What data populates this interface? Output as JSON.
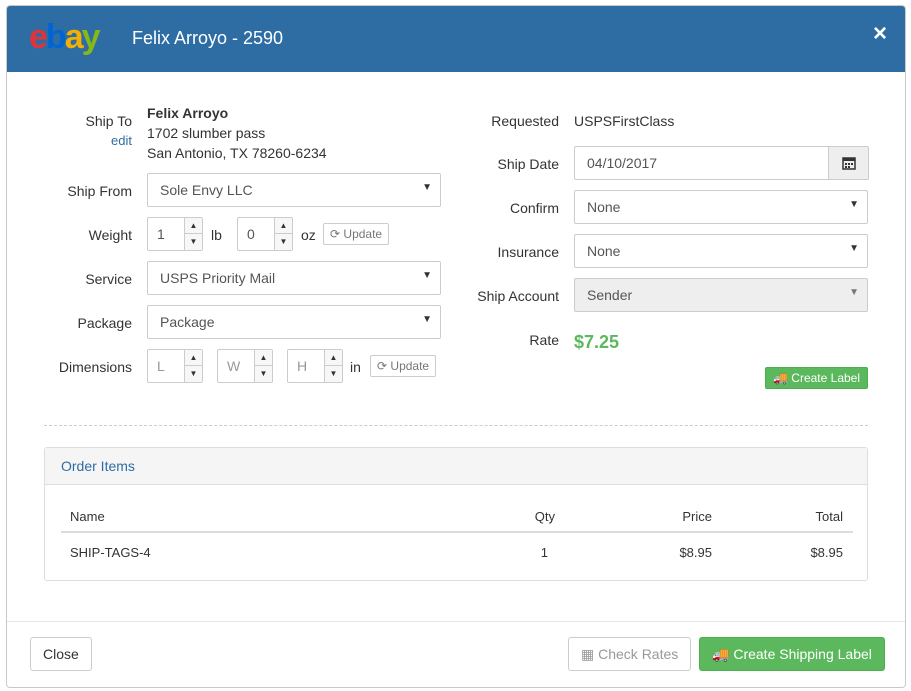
{
  "header": {
    "title": "Felix Arroyo - 2590",
    "close_label": "×",
    "logo": {
      "e": "e",
      "b": "b",
      "a": "a",
      "y": "y"
    }
  },
  "left": {
    "ship_to_label": "Ship To",
    "edit_label": "edit",
    "ship_to_name": "Felix Arroyo",
    "ship_to_line1": "1702 slumber pass",
    "ship_to_line2": "San Antonio, TX 78260-6234",
    "ship_from_label": "Ship From",
    "ship_from_value": "Sole Envy LLC",
    "weight_label": "Weight",
    "weight_lb": "1",
    "lb_unit": "lb",
    "weight_oz": "0",
    "oz_unit": "oz",
    "update_label": "Update",
    "service_label": "Service",
    "service_value": "USPS Priority Mail",
    "package_label": "Package",
    "package_value": "Package",
    "dimensions_label": "Dimensions",
    "dim_l_placeholder": "L",
    "dim_w_placeholder": "W",
    "dim_h_placeholder": "H",
    "in_unit": "in",
    "update2_label": "Update"
  },
  "right": {
    "requested_label": "Requested",
    "requested_value": "USPSFirstClass",
    "ship_date_label": "Ship Date",
    "ship_date_value": "04/10/2017",
    "confirm_label": "Confirm",
    "confirm_value": "None",
    "insurance_label": "Insurance",
    "insurance_value": "None",
    "ship_account_label": "Ship Account",
    "ship_account_value": "Sender",
    "rate_label": "Rate",
    "rate_value": "$7.25",
    "create_label": "Create Label"
  },
  "order_items": {
    "title": "Order Items",
    "columns": {
      "name": "Name",
      "qty": "Qty",
      "price": "Price",
      "total": "Total"
    },
    "rows": [
      {
        "name": "SHIP-TAGS-4",
        "qty": "1",
        "price": "$8.95",
        "total": "$8.95"
      }
    ]
  },
  "footer": {
    "close_label": "Close",
    "check_rates_label": "Check Rates",
    "create_shipping_label": "Create Shipping Label"
  },
  "colors": {
    "header_bg": "#2e6da4",
    "accent_green": "#5cb85c",
    "link_blue": "#2e6da4"
  }
}
